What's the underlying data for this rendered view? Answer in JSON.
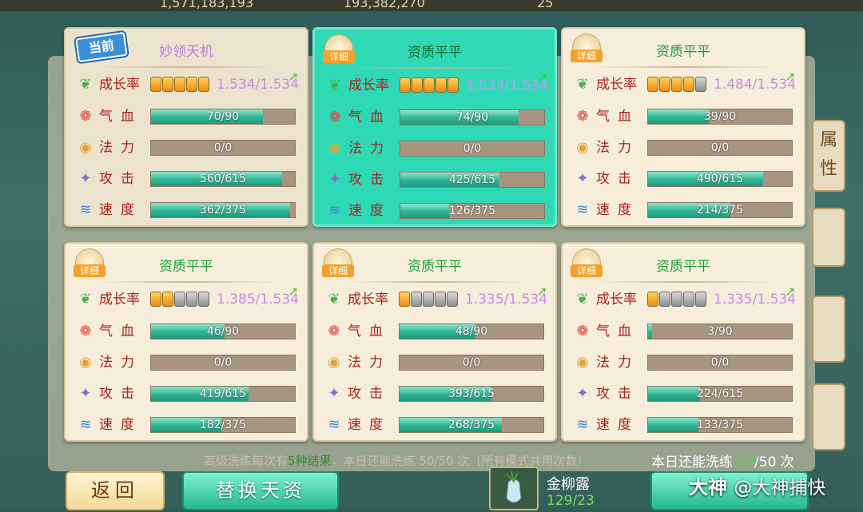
{
  "top_bar": {
    "fragments": [
      "1,571,183,193",
      "193,382,270",
      "25"
    ]
  },
  "side_tab_label": "属性",
  "cards": [
    {
      "title": "妙领天机",
      "badge": "当前",
      "current": true,
      "selected": false,
      "growth": {
        "pips_on": 5,
        "pips_total": 5,
        "value": "1.534/1.534"
      },
      "stats": [
        {
          "label": "气血",
          "text": "70/90",
          "fraction": 0.78
        },
        {
          "label": "法力",
          "text": "0/0",
          "fraction": 0
        },
        {
          "label": "攻击",
          "text": "560/615",
          "fraction": 0.91
        },
        {
          "label": "速度",
          "text": "362/375",
          "fraction": 0.965
        }
      ]
    },
    {
      "title": "资质平平",
      "badge": "详细",
      "current": false,
      "selected": true,
      "growth": {
        "pips_on": 5,
        "pips_total": 5,
        "value": "1.534/1.534"
      },
      "stats": [
        {
          "label": "气血",
          "text": "74/90",
          "fraction": 0.82
        },
        {
          "label": "法力",
          "text": "0/0",
          "fraction": 0
        },
        {
          "label": "攻击",
          "text": "425/615",
          "fraction": 0.69
        },
        {
          "label": "速度",
          "text": "126/375",
          "fraction": 0.34
        }
      ]
    },
    {
      "title": "资质平平",
      "badge": "详细",
      "current": false,
      "selected": false,
      "growth": {
        "pips_on": 4,
        "pips_total": 5,
        "value": "1.484/1.534"
      },
      "stats": [
        {
          "label": "气血",
          "text": "39/90",
          "fraction": 0.43
        },
        {
          "label": "法力",
          "text": "0/0",
          "fraction": 0
        },
        {
          "label": "攻击",
          "text": "490/615",
          "fraction": 0.8
        },
        {
          "label": "速度",
          "text": "214/375",
          "fraction": 0.57
        }
      ]
    },
    {
      "title": "资质平平",
      "badge": "详细",
      "current": false,
      "selected": false,
      "growth": {
        "pips_on": 2,
        "pips_total": 5,
        "value": "1.385/1.534"
      },
      "stats": [
        {
          "label": "气血",
          "text": "46/90",
          "fraction": 0.51
        },
        {
          "label": "法力",
          "text": "0/0",
          "fraction": 0
        },
        {
          "label": "攻击",
          "text": "419/615",
          "fraction": 0.68
        },
        {
          "label": "速度",
          "text": "182/375",
          "fraction": 0.49
        }
      ]
    },
    {
      "title": "资质平平",
      "badge": "详细",
      "current": false,
      "selected": false,
      "growth": {
        "pips_on": 1,
        "pips_total": 5,
        "value": "1.335/1.534"
      },
      "stats": [
        {
          "label": "气血",
          "text": "48/90",
          "fraction": 0.53
        },
        {
          "label": "法力",
          "text": "0/0",
          "fraction": 0
        },
        {
          "label": "攻击",
          "text": "393/615",
          "fraction": 0.64
        },
        {
          "label": "速度",
          "text": "268/375",
          "fraction": 0.71
        }
      ]
    },
    {
      "title": "资质平平",
      "badge": "详细",
      "current": false,
      "selected": false,
      "growth": {
        "pips_on": 1,
        "pips_total": 5,
        "value": "1.335/1.534"
      },
      "stats": [
        {
          "label": "气血",
          "text": "3/90",
          "fraction": 0.03
        },
        {
          "label": "法力",
          "text": "0/0",
          "fraction": 0
        },
        {
          "label": "攻击",
          "text": "224/615",
          "fraction": 0.36
        },
        {
          "label": "速度",
          "text": "133/375",
          "fraction": 0.35
        }
      ]
    }
  ],
  "growth_label": "成长率",
  "info_text_prefix": "高级洗练每次有",
  "info_text_highlight": "5种结果",
  "info_text_suffix": "，本日还能洗练 50/50 次（所有模式共用次数）",
  "remaining": {
    "prefix": "本日还能洗练 ",
    "current": "50",
    "suffix": "/50 次"
  },
  "buttons": {
    "back": "返回",
    "replace": "替换天资"
  },
  "item": {
    "name": "金柳露",
    "count": "129/23"
  },
  "watermark": {
    "brand": "大神",
    "handle": "@大神捕快"
  },
  "colors": {
    "selected_card": "#2fd9b6",
    "bar_fill": "#2fb594",
    "growth_value": "#c78ae6",
    "title_green": "#1d9a3a"
  }
}
